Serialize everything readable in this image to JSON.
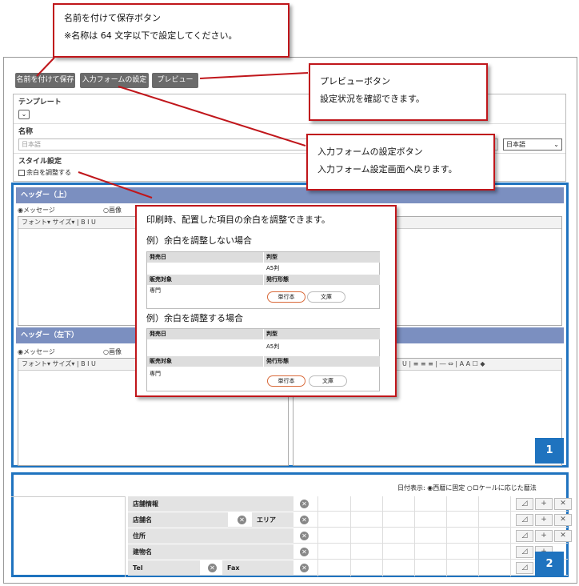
{
  "toolbar": {
    "save_as_label": "名前を付けて保存",
    "input_form_label": "入力フォームの設定",
    "preview_label": "プレビュー"
  },
  "template": {
    "template_label": "テンプレート",
    "name_label": "名称",
    "name_placeholder": "日本語",
    "lang_value": "日本語",
    "style_label": "スタイル設定",
    "margin_checkbox": "余白を調整する"
  },
  "header_top": {
    "title": "ヘッダー（上）",
    "radio_message": "◉メッセージ",
    "radio_image": "○画像",
    "toolbar_left": "フォント▾  サイズ▾  |  B  I  U"
  },
  "header_bottom_left": {
    "title": "ヘッダー（左下）",
    "radio_message": "◉メッセージ",
    "radio_image": "○画像",
    "toolbar_left": "フォント▾  サイズ▾  |  B  I  U",
    "toolbar_right": "U | ≡ ≡ ≡ | ― ⇔ | A A ☐ ◆"
  },
  "badges": {
    "one": "1",
    "two": "2"
  },
  "region2": {
    "date_display_label": "日付表示:",
    "option_western": "西暦に固定",
    "option_locale": "ロケールに応じた暦法",
    "rows": [
      {
        "left": "店舗情報",
        "right": ""
      },
      {
        "left": "店舗名",
        "right": "エリア"
      },
      {
        "left": "住所",
        "right": ""
      },
      {
        "left": "建物名",
        "right": ""
      },
      {
        "left": "Tel",
        "right": "Fax"
      }
    ]
  },
  "callouts": {
    "save_as_line1": "名前を付けて保存ボタン",
    "save_as_line2": "※名称は 64 文字以下で設定してください。",
    "preview_line1": "プレビューボタン",
    "preview_line2": "設定状況を確認できます。",
    "input_form_line1": "入力フォームの設定ボタン",
    "input_form_line2": "入力フォーム設定画面へ戻ります。",
    "margin_intro": "印刷時、配置した項目の余白を調整できます。",
    "example_no_adjust": "例）余白を調整しない場合",
    "example_adjust": "例）余白を調整する場合"
  },
  "example_table": {
    "release_date": "発売日",
    "format": "判型",
    "format_value": "A5判",
    "target": "販売対象",
    "target_value": "専門",
    "publication": "発行形態",
    "pill_tankobon": "単行本",
    "pill_bunko": "文庫"
  }
}
